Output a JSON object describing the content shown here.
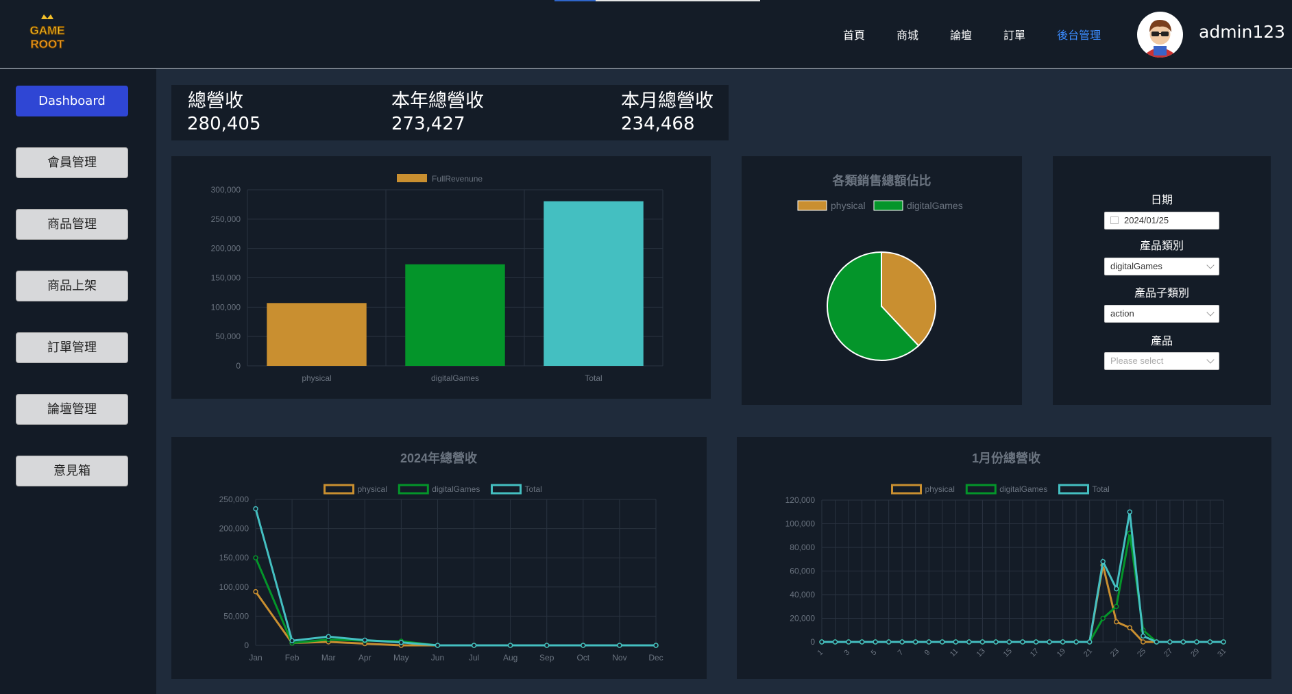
{
  "header": {
    "logo_text": "GAME ROOT",
    "nav": [
      {
        "label": "首頁"
      },
      {
        "label": "商城"
      },
      {
        "label": "論壇"
      },
      {
        "label": "訂單"
      },
      {
        "label": "後台管理",
        "active": true
      }
    ],
    "username": "admin123"
  },
  "sidebar": {
    "items": [
      {
        "label": "Dashboard",
        "active": true
      },
      {
        "label": "會員管理"
      },
      {
        "label": "商品管理"
      },
      {
        "label": "商品上架"
      },
      {
        "label": "訂單管理"
      },
      {
        "label": "論壇管理"
      },
      {
        "label": "意見箱"
      }
    ]
  },
  "stats": {
    "total_label": "總營收",
    "total_value": "280,405",
    "year_label": "本年總營收",
    "year_value": "273,427",
    "month_label": "本月總營收",
    "month_value": "234,468"
  },
  "filters": {
    "date_label": "日期",
    "date_value": "2024/01/25",
    "category_label": "產品類別",
    "category_value": "digitalGames",
    "subcategory_label": "產品子類別",
    "subcategory_value": "action",
    "product_label": "產品",
    "product_placeholder": "Please select"
  },
  "colors": {
    "physical": "#c98f30",
    "digitalGames": "#04952a",
    "total": "#44bfc1",
    "accent": "#3b8cff"
  },
  "chart_data": [
    {
      "type": "bar",
      "title": "",
      "categories": [
        "physical",
        "digitalGames",
        "Total"
      ],
      "series": [
        {
          "name": "FullRevenune",
          "values": [
            107000,
            173000,
            280405
          ]
        }
      ],
      "ylim": [
        0,
        300000
      ],
      "yticks": [
        0,
        50000,
        100000,
        150000,
        200000,
        250000,
        300000
      ],
      "legend": "top"
    },
    {
      "type": "pie",
      "title": "各類銷售總額佔比",
      "labels": [
        "physical",
        "digitalGames"
      ],
      "values": [
        38,
        62
      ],
      "legend": "top"
    },
    {
      "type": "line",
      "title": "2024年總營收",
      "x": [
        "Jan",
        "Feb",
        "Mar",
        "Apr",
        "May",
        "Jun",
        "Jul",
        "Aug",
        "Sep",
        "Oct",
        "Nov",
        "Dec"
      ],
      "series": [
        {
          "name": "physical",
          "values": [
            92000,
            4000,
            6000,
            3000,
            0,
            0,
            0,
            0,
            0,
            0,
            0,
            0
          ]
        },
        {
          "name": "digitalGames",
          "values": [
            150000,
            4000,
            10000,
            8000,
            7000,
            0,
            0,
            0,
            0,
            0,
            0,
            0
          ]
        },
        {
          "name": "Total",
          "values": [
            234000,
            8000,
            15000,
            9000,
            5000,
            0,
            0,
            0,
            0,
            0,
            0,
            0
          ]
        }
      ],
      "ylim": [
        0,
        250000
      ],
      "yticks": [
        0,
        50000,
        100000,
        150000,
        200000,
        250000
      ],
      "legend": "top"
    },
    {
      "type": "line",
      "title": "1月份總營收",
      "x": [
        1,
        2,
        3,
        4,
        5,
        6,
        7,
        8,
        9,
        10,
        11,
        12,
        13,
        14,
        15,
        16,
        17,
        18,
        19,
        20,
        21,
        22,
        23,
        24,
        25,
        26,
        27,
        28,
        29,
        30,
        31
      ],
      "xtick_labels": [
        "1",
        "3",
        "5",
        "7",
        "9",
        "11",
        "13",
        "15",
        "17",
        "19",
        "21",
        "23",
        "25",
        "27",
        "29",
        "31"
      ],
      "series": [
        {
          "name": "physical",
          "values": [
            0,
            0,
            0,
            0,
            0,
            0,
            0,
            0,
            0,
            0,
            0,
            0,
            0,
            0,
            0,
            0,
            0,
            0,
            0,
            0,
            0,
            65000,
            17000,
            12000,
            0,
            0,
            0,
            0,
            0,
            0,
            0
          ]
        },
        {
          "name": "digitalGames",
          "values": [
            0,
            0,
            0,
            0,
            0,
            0,
            0,
            0,
            0,
            0,
            0,
            0,
            0,
            0,
            0,
            0,
            0,
            0,
            0,
            0,
            0,
            20000,
            30000,
            92000,
            10000,
            0,
            0,
            0,
            0,
            0,
            0
          ]
        },
        {
          "name": "Total",
          "values": [
            0,
            0,
            0,
            0,
            0,
            0,
            0,
            0,
            0,
            0,
            0,
            0,
            0,
            0,
            0,
            0,
            0,
            0,
            0,
            0,
            0,
            68000,
            45000,
            110000,
            5000,
            0,
            0,
            0,
            0,
            0,
            0
          ]
        }
      ],
      "ylim": [
        0,
        120000
      ],
      "yticks": [
        0,
        20000,
        40000,
        60000,
        80000,
        100000,
        120000
      ],
      "legend": "top"
    }
  ]
}
